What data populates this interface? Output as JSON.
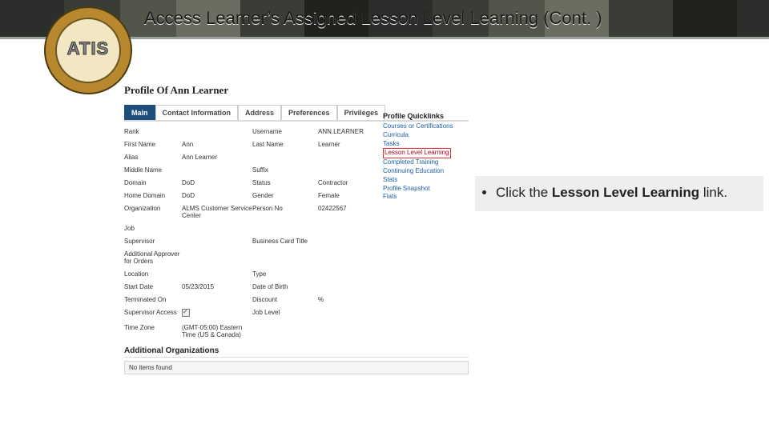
{
  "title": "Access Learner’s Assigned Lesson Level Learning (Cont. )",
  "badge": {
    "acronym": "ATIS"
  },
  "profile": {
    "heading": "Profile Of Ann Learner",
    "tabs": [
      "Main",
      "Contact Information",
      "Address",
      "Preferences",
      "Privileges"
    ],
    "active_tab": "Main",
    "fields": [
      {
        "l1": "Rank",
        "v1": "",
        "l2": "Username",
        "v2": "ANN.LEARNER"
      },
      {
        "l1": "First Name",
        "v1": "Ann",
        "l2": "Last Name",
        "v2": "Learner"
      },
      {
        "l1": "Alias",
        "v1": "Ann Learner",
        "l2": "",
        "v2": ""
      },
      {
        "l1": "Middle Name",
        "v1": "",
        "l2": "Suffix",
        "v2": ""
      },
      {
        "l1": "Domain",
        "v1": "DoD",
        "l2": "Status",
        "v2": "Contractor"
      },
      {
        "l1": "Home Domain",
        "v1": "DoD",
        "l2": "Gender",
        "v2": "Female"
      },
      {
        "l1": "Organization",
        "v1": "ALMS Customer Service Center",
        "l2": "Person No",
        "v2": "02422567"
      },
      {
        "l1": "Job",
        "v1": "",
        "l2": "",
        "v2": ""
      },
      {
        "l1": "Supervisor",
        "v1": "",
        "l2": "Business Card Title",
        "v2": ""
      },
      {
        "l1": "Additional Approver for Orders",
        "v1": "",
        "l2": "",
        "v2": ""
      },
      {
        "l1": "Location",
        "v1": "",
        "l2": "Type",
        "v2": ""
      },
      {
        "l1": "Start Date",
        "v1": "05/23/2015",
        "l2": "Date of Birth",
        "v2": ""
      },
      {
        "l1": "Terminated On",
        "v1": "",
        "l2": "Discount",
        "v2": "%"
      },
      {
        "l1": "Supervisor Access",
        "v1": "[check]",
        "l2": "Job Level",
        "v2": ""
      },
      {
        "l1": "Time Zone",
        "v1": "(GMT-05:00) Eastern Time (US & Canada)",
        "l2": "",
        "v2": ""
      }
    ],
    "additional_heading": "Additional Organizations",
    "no_items": "No items found"
  },
  "quicklinks": {
    "heading": "Profile Quicklinks",
    "items": [
      {
        "label": "Courses or Certifications",
        "highlight": false
      },
      {
        "label": "Curricula",
        "highlight": false
      },
      {
        "label": "Tasks",
        "highlight": false
      },
      {
        "label": "Lesson Level Learning",
        "highlight": true
      },
      {
        "label": "Completed Training",
        "highlight": false
      },
      {
        "label": "Continuing Education Stats",
        "highlight": false
      },
      {
        "label": "Profile Snapshot",
        "highlight": false
      },
      {
        "label": "Flats",
        "highlight": false
      }
    ]
  },
  "callout": {
    "before": "Click the ",
    "strong": "Lesson Level Learning",
    "after": " link."
  }
}
